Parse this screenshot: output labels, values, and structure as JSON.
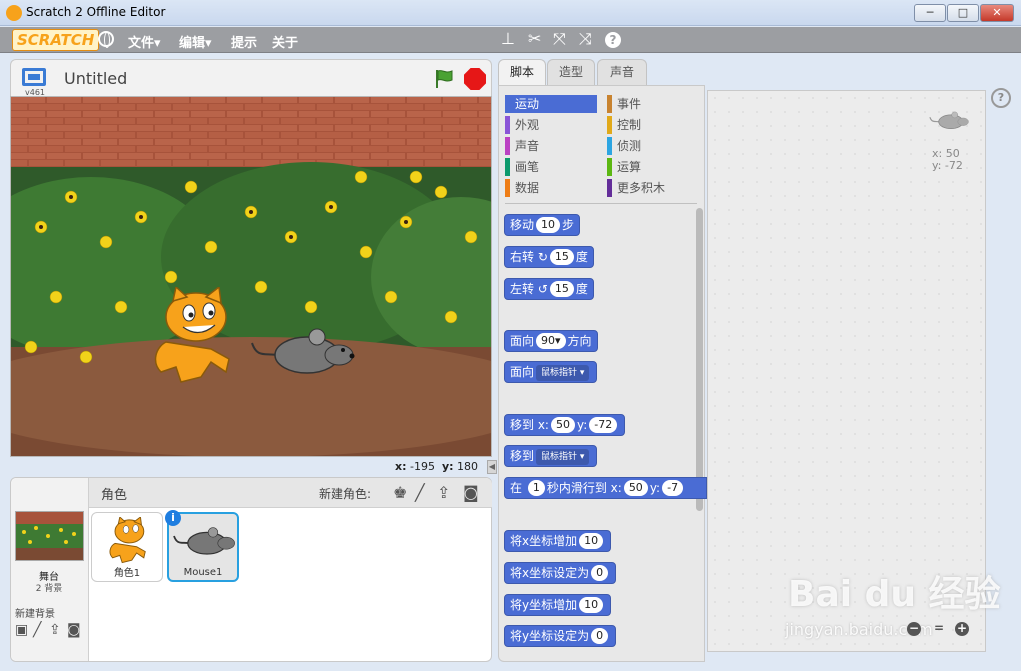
{
  "window": {
    "title": "Scratch 2 Offline Editor",
    "minimize": "─",
    "maximize": "□",
    "close": "✕"
  },
  "menubar": {
    "logo": "SCRATCH",
    "items": [
      "文件▾",
      "编辑▾",
      "提示",
      "关于"
    ],
    "tools": [
      "stamp-icon",
      "cut-icon",
      "grow-icon",
      "shrink-icon",
      "help-icon"
    ]
  },
  "stage": {
    "version": "v461",
    "title": "Untitled",
    "mouse_x": "-195",
    "mouse_y": "180",
    "x_label": "x:",
    "y_label": "y:"
  },
  "sprites": {
    "header": "角色",
    "new_sprite": "新建角色:",
    "stage_label": "舞台",
    "backdrops": "2 背景",
    "new_backdrop": "新建背景",
    "items": [
      {
        "name": "角色1"
      },
      {
        "name": "Mouse1"
      }
    ],
    "info": "i"
  },
  "tabs": [
    "脚本",
    "造型",
    "声音"
  ],
  "categories": [
    {
      "label": "运动",
      "color": "#4a6cd4",
      "selected": true
    },
    {
      "label": "事件",
      "color": "#c88330"
    },
    {
      "label": "外观",
      "color": "#8a55d7"
    },
    {
      "label": "控制",
      "color": "#e1a91a"
    },
    {
      "label": "声音",
      "color": "#bb42c3"
    },
    {
      "label": "侦测",
      "color": "#2ca5e2"
    },
    {
      "label": "画笔",
      "color": "#0e9a6c"
    },
    {
      "label": "运算",
      "color": "#5cb712"
    },
    {
      "label": "数据",
      "color": "#ee7d16"
    },
    {
      "label": "更多积木",
      "color": "#632d99"
    }
  ],
  "blocks": {
    "move": [
      "移动",
      "10",
      "步"
    ],
    "turn_right": [
      "右转",
      "15",
      "度"
    ],
    "turn_left": [
      "左转",
      "15",
      "度"
    ],
    "point_dir": [
      "面向",
      "90▾",
      "方向"
    ],
    "point_to": [
      "面向",
      "鼠标指针"
    ],
    "goto_xy": [
      "移到 x:",
      "50",
      "y:",
      "-72"
    ],
    "goto": [
      "移到",
      "鼠标指针"
    ],
    "glide": [
      "在",
      "1",
      "秒内滑行到 x:",
      "50",
      "y:",
      "-7"
    ],
    "change_x": [
      "将x坐标增加",
      "10"
    ],
    "set_x": [
      "将x坐标设定为",
      "0"
    ],
    "change_y": [
      "将y坐标增加",
      "10"
    ],
    "set_y": [
      "将y坐标设定为",
      "0"
    ]
  },
  "script_area": {
    "sprite_x": "x: 50",
    "sprite_y": "y: -72",
    "help": "?",
    "zoom_out": "−",
    "zoom_reset": "=",
    "zoom_in": "+"
  },
  "watermark": {
    "main": "Bai du 经验",
    "sub": "jingyan.baidu.com"
  },
  "colors": {
    "motion": "#4a6cd4",
    "titlebar": "#c9d8ee",
    "menubar": "#9c9ea2"
  }
}
